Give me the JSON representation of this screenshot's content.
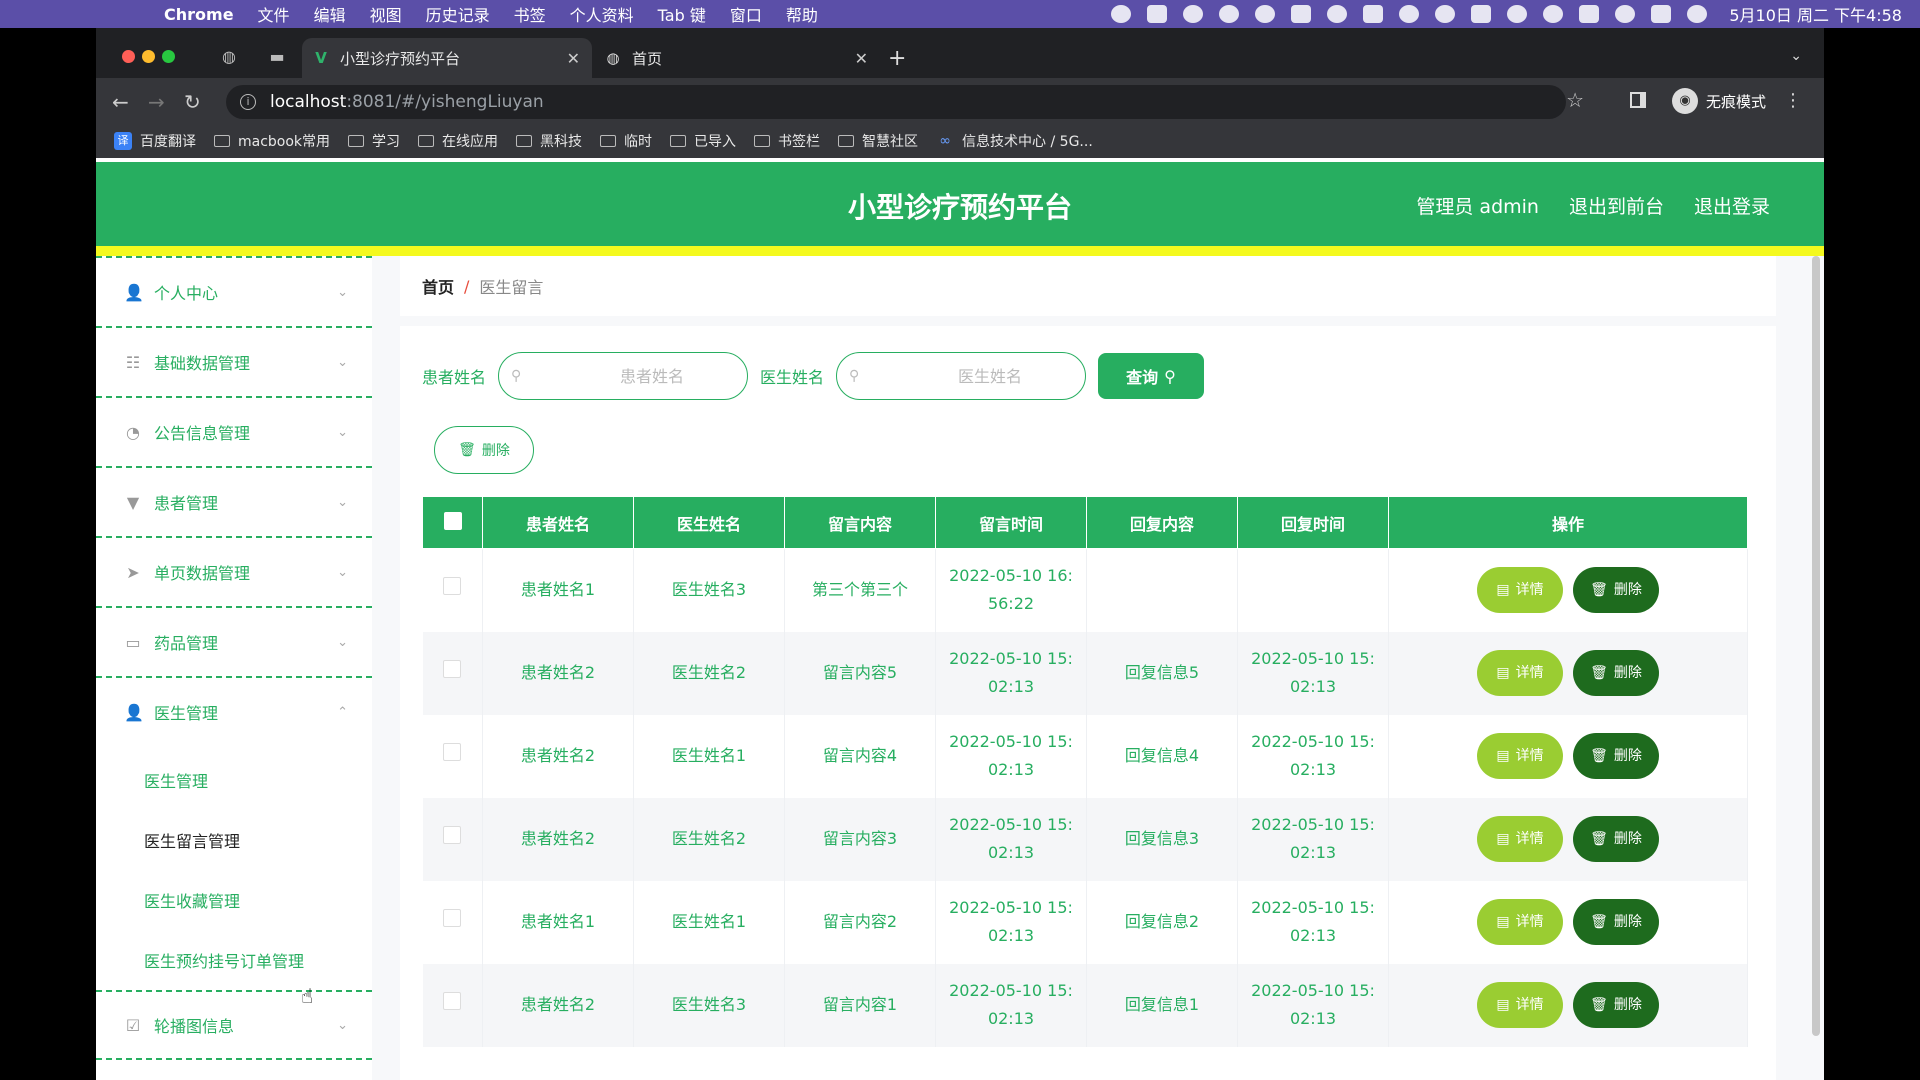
{
  "os_menubar": {
    "app": "Chrome",
    "items": [
      "文件",
      "编辑",
      "视图",
      "历史记录",
      "书签",
      "个人资料",
      "Tab 键",
      "窗口",
      "帮助"
    ],
    "clock": "5月10日 周二 下午4:58"
  },
  "browser": {
    "tabs": [
      {
        "title": "小型诊疗预约平台",
        "active": true
      },
      {
        "title": "首页",
        "active": false
      }
    ],
    "url_host": "localhost",
    "url_path": ":8081/#/yishengLiuyan",
    "profile_label": "无痕模式",
    "bookmarks": [
      "百度翻译",
      "macbook常用",
      "学习",
      "在线应用",
      "黑科技",
      "临时",
      "已导入",
      "书签栏",
      "智慧社区",
      "信息技术中心 / 5G..."
    ]
  },
  "header": {
    "title": "小型诊疗预约平台",
    "admin": "管理员 admin",
    "to_front": "退出到前台",
    "logout": "退出登录"
  },
  "sidebar": {
    "groups": [
      {
        "label": "个人中心",
        "icon": "user-icon",
        "chevron": "⌄"
      },
      {
        "label": "基础数据管理",
        "icon": "sliders-icon",
        "chevron": "⌄"
      },
      {
        "label": "公告信息管理",
        "icon": "gauge-icon",
        "chevron": "⌄"
      },
      {
        "label": "患者管理",
        "icon": "stamp-icon",
        "chevron": "⌄"
      },
      {
        "label": "单页数据管理",
        "icon": "send-icon",
        "chevron": "⌄"
      },
      {
        "label": "药品管理",
        "icon": "message-icon",
        "chevron": "⌄"
      },
      {
        "label": "医生管理",
        "icon": "doctor-icon",
        "chevron": "⌃"
      }
    ],
    "sub_items": [
      "医生管理",
      "医生留言管理",
      "医生收藏管理",
      "医生预约挂号订单管理"
    ],
    "last_group": {
      "label": "轮播图信息",
      "icon": "checkbox-icon",
      "chevron": "⌄"
    }
  },
  "breadcrumb": {
    "home": "首页",
    "separator": "/",
    "current": "医生留言"
  },
  "search": {
    "patient_label": "患者姓名",
    "patient_placeholder": "患者姓名",
    "doctor_label": "医生姓名",
    "doctor_placeholder": "医生姓名",
    "query_button": "查询"
  },
  "delete_button": "删除",
  "table": {
    "headers": [
      "患者姓名",
      "医生姓名",
      "留言内容",
      "留言时间",
      "回复内容",
      "回复时间",
      "操作"
    ],
    "rows": [
      {
        "patient": "患者姓名1",
        "doctor": "医生姓名3",
        "message": "第三个第三个",
        "msg_time_1": "2022-05-10 16:",
        "msg_time_2": "56:22",
        "reply": "",
        "reply_time_1": "",
        "reply_time_2": ""
      },
      {
        "patient": "患者姓名2",
        "doctor": "医生姓名2",
        "message": "留言内容5",
        "msg_time_1": "2022-05-10 15:",
        "msg_time_2": "02:13",
        "reply": "回复信息5",
        "reply_time_1": "2022-05-10 15:",
        "reply_time_2": "02:13"
      },
      {
        "patient": "患者姓名2",
        "doctor": "医生姓名1",
        "message": "留言内容4",
        "msg_time_1": "2022-05-10 15:",
        "msg_time_2": "02:13",
        "reply": "回复信息4",
        "reply_time_1": "2022-05-10 15:",
        "reply_time_2": "02:13"
      },
      {
        "patient": "患者姓名2",
        "doctor": "医生姓名2",
        "message": "留言内容3",
        "msg_time_1": "2022-05-10 15:",
        "msg_time_2": "02:13",
        "reply": "回复信息3",
        "reply_time_1": "2022-05-10 15:",
        "reply_time_2": "02:13"
      },
      {
        "patient": "患者姓名1",
        "doctor": "医生姓名1",
        "message": "留言内容2",
        "msg_time_1": "2022-05-10 15:",
        "msg_time_2": "02:13",
        "reply": "回复信息2",
        "reply_time_1": "2022-05-10 15:",
        "reply_time_2": "02:13"
      },
      {
        "patient": "患者姓名2",
        "doctor": "医生姓名3",
        "message": "留言内容1",
        "msg_time_1": "2022-05-10 15:",
        "msg_time_2": "02:13",
        "reply": "回复信息1",
        "reply_time_1": "2022-05-10 15:",
        "reply_time_2": "02:13"
      }
    ],
    "detail_label": "详情",
    "delete_label": "删除"
  },
  "colors": {
    "primary": "#27ae60",
    "accent_stripe": "#f4f91e",
    "detail_button": "#9acd32",
    "delete_button": "#1e6b1e"
  }
}
